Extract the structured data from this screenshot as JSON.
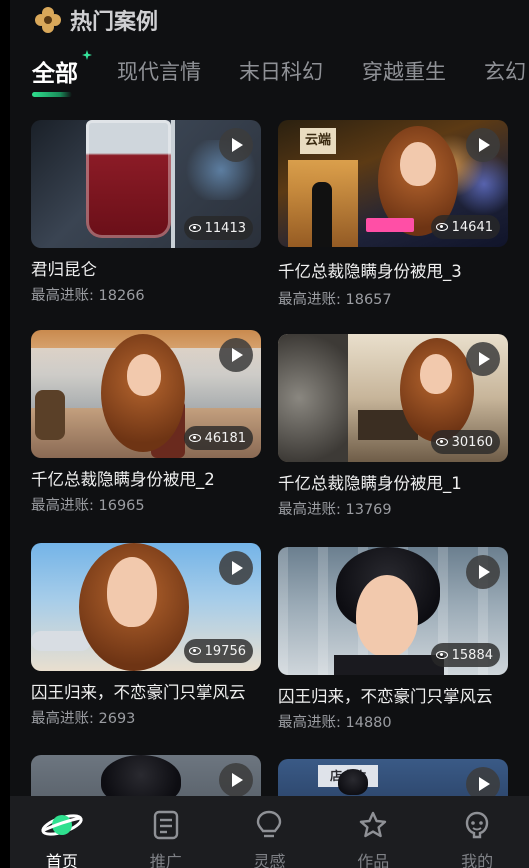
{
  "section": {
    "title": "热门案例",
    "icon": "flower-icon"
  },
  "tabs": [
    {
      "label": "全部",
      "active": true
    },
    {
      "label": "现代言情"
    },
    {
      "label": "末日科幻"
    },
    {
      "label": "穿越重生"
    },
    {
      "label": "玄幻"
    }
  ],
  "cards": [
    {
      "title": "君归昆仑",
      "meta_label": "最高进账: 18266",
      "views": "11413"
    },
    {
      "title": "千亿总裁隐瞒身份被甩_3",
      "meta_label": "最高进账: 18657",
      "views": "14641",
      "sign": "云端"
    },
    {
      "title": "千亿总裁隐瞒身份被甩_2",
      "meta_label": "最高进账: 16965",
      "views": "46181"
    },
    {
      "title": "千亿总裁隐瞒身份被甩_1",
      "meta_label": "最高进账: 13769",
      "views": "30160"
    },
    {
      "title": "囚王归来，不恋豪门只掌风云",
      "meta_label": "最高进账: 2693",
      "views": "19756"
    },
    {
      "title": "囚王归来，不恋豪门只掌风云",
      "meta_label": "最高进账: 14880",
      "views": "15884"
    },
    {
      "views": ""
    },
    {
      "views": "",
      "sign": "店大佐"
    }
  ],
  "nav": [
    {
      "label": "首页",
      "icon": "planet-icon",
      "active": true
    },
    {
      "label": "推广",
      "icon": "document-icon"
    },
    {
      "label": "灵感",
      "icon": "lightbulb-icon"
    },
    {
      "label": "作品",
      "icon": "star-icon"
    },
    {
      "label": "我的",
      "icon": "user-icon"
    }
  ],
  "colors": {
    "accent": "#2fe08f",
    "background": "#0f1012",
    "nav_bg": "#1c1d20"
  }
}
